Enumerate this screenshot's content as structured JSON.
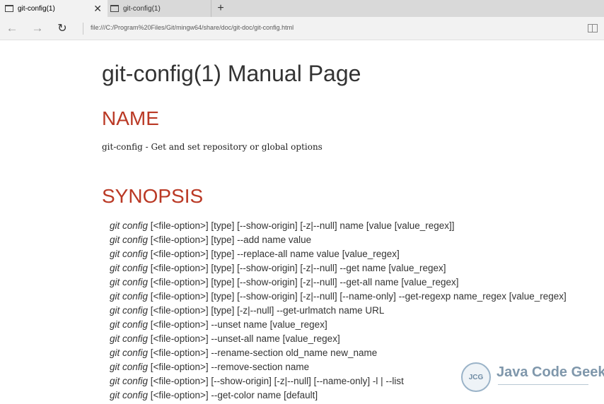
{
  "browser": {
    "tabs": [
      {
        "label": "git-config(1)",
        "active": true,
        "close": "✕"
      },
      {
        "label": "git-config(1)",
        "active": false
      }
    ],
    "new_tab": "+",
    "nav": {
      "back": "←",
      "forward": "→",
      "refresh": "↻"
    },
    "address": "file:///C:/Program%20Files/Git/mingw64/share/doc/git-doc/git-config.html"
  },
  "page": {
    "title": "git-config(1) Manual Page",
    "name_heading": "NAME",
    "name_description": "git-config - Get and set repository or global options",
    "synopsis_heading": "SYNOPSIS",
    "synopsis": [
      {
        "cmd": "git config",
        "args": " [<file-option>] [type] [--show-origin] [-z|--null] name [value [value_regex]]"
      },
      {
        "cmd": "git config",
        "args": " [<file-option>] [type] --add name value"
      },
      {
        "cmd": "git config",
        "args": " [<file-option>] [type] --replace-all name value [value_regex]"
      },
      {
        "cmd": "git config",
        "args": " [<file-option>] [type] [--show-origin] [-z|--null] --get name [value_regex]"
      },
      {
        "cmd": "git config",
        "args": " [<file-option>] [type] [--show-origin] [-z|--null] --get-all name [value_regex]"
      },
      {
        "cmd": "git config",
        "args": " [<file-option>] [type] [--show-origin] [-z|--null] [--name-only] --get-regexp name_regex [value_regex]"
      },
      {
        "cmd": "git config",
        "args": " [<file-option>] [type] [-z|--null] --get-urlmatch name URL"
      },
      {
        "cmd": "git config",
        "args": " [<file-option>] --unset name [value_regex]"
      },
      {
        "cmd": "git config",
        "args": " [<file-option>] --unset-all name [value_regex]"
      },
      {
        "cmd": "git config",
        "args": " [<file-option>] --rename-section old_name new_name"
      },
      {
        "cmd": "git config",
        "args": " [<file-option>] --remove-section name"
      },
      {
        "cmd": "git config",
        "args": " [<file-option>] [--show-origin] [-z|--null] [--name-only] -l | --list"
      },
      {
        "cmd": "git config",
        "args": " [<file-option>] --get-color name [default]"
      }
    ]
  },
  "watermark": {
    "logo": "JCG",
    "text": "Java Code Geeks"
  },
  "colors": {
    "heading_red": "#ba3925",
    "text": "#333333"
  }
}
